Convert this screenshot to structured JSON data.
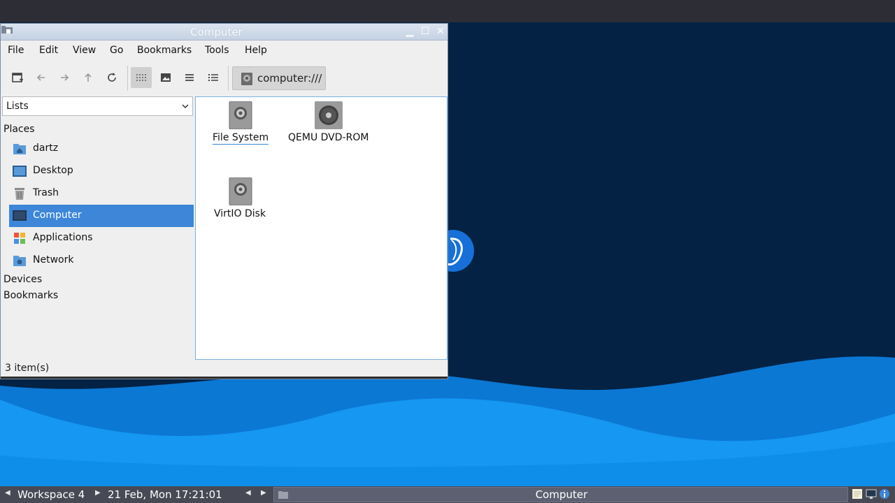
{
  "window": {
    "title": "Computer",
    "buttons": {
      "minimize": "▁",
      "maximize": "☐",
      "close": "✕"
    }
  },
  "menubar": [
    "File",
    "Edit",
    "View",
    "Go",
    "Bookmarks",
    "Tools",
    "Help"
  ],
  "toolbar": {
    "buttons": [
      "new-window-icon",
      "back-arrow-icon",
      "forward-arrow-icon",
      "up-arrow-icon",
      "reload-icon",
      "icon-view-icon",
      "thumbnail-view-icon",
      "compact-view-icon",
      "detailed-list-view-icon"
    ],
    "location": "computer:///"
  },
  "sidebar": {
    "selector": "Lists",
    "places_header": "Places",
    "places": [
      {
        "label": "dartz",
        "icon": "home-folder-icon"
      },
      {
        "label": "Desktop",
        "icon": "desktop-icon"
      },
      {
        "label": "Trash",
        "icon": "trash-icon"
      },
      {
        "label": "Computer",
        "icon": "computer-icon",
        "selected": true
      },
      {
        "label": "Applications",
        "icon": "applications-icon"
      },
      {
        "label": "Network",
        "icon": "network-folder-icon"
      }
    ],
    "devices_header": "Devices",
    "bookmarks_header": "Bookmarks"
  },
  "files": [
    {
      "label": "File System",
      "icon": "hard-disk-icon",
      "focused": true
    },
    {
      "label": "QEMU DVD-ROM",
      "icon": "optical-drive-icon"
    },
    {
      "label": "VirtIO Disk",
      "icon": "hard-disk-icon"
    }
  ],
  "statusbar": {
    "text": "3 item(s)"
  },
  "taskbar": {
    "workspace": "Workspace 4",
    "clock": "21 Feb, Mon 17:21:01",
    "task": "Computer"
  },
  "colors": {
    "selection": "#3d86d8",
    "desktop_dark": "#032244",
    "wave_blue": "#0a8ff0",
    "taskbar": "#474a55"
  }
}
